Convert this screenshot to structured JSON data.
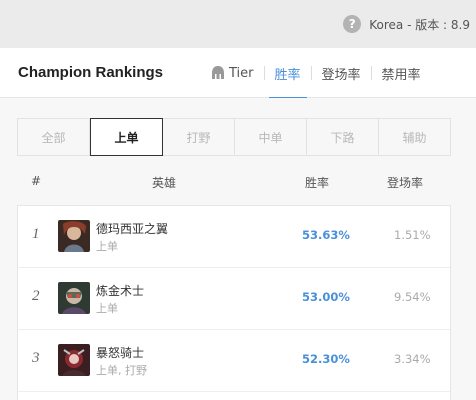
{
  "region": {
    "text": "Korea - 版本 : 8.9",
    "help_icon": "?"
  },
  "header": {
    "title": "Champion Rankings",
    "tabs": [
      {
        "label": "Tier",
        "icon": "helmet-icon",
        "active": false
      },
      {
        "label": "胜率",
        "active": true
      },
      {
        "label": "登场率",
        "active": false
      },
      {
        "label": "禁用率",
        "active": false
      }
    ]
  },
  "filters": [
    {
      "label": "全部",
      "active": false
    },
    {
      "label": "上单",
      "active": true
    },
    {
      "label": "打野",
      "active": false
    },
    {
      "label": "中单",
      "active": false
    },
    {
      "label": "下路",
      "active": false
    },
    {
      "label": "辅助",
      "active": false
    }
  ],
  "columns": {
    "rank": "#",
    "champion": "英雄",
    "winrate": "胜率",
    "pickrate": "登场率"
  },
  "rows": [
    {
      "rank": "1",
      "name": "德玛西亚之翼",
      "positions": "上单",
      "winrate": "53.63%",
      "pickrate": "1.51%",
      "avatar_color": "#6b4a3a"
    },
    {
      "rank": "2",
      "name": "炼金术士",
      "positions": "上单",
      "winrate": "53.00%",
      "pickrate": "9.54%",
      "avatar_color": "#5a6a5a"
    },
    {
      "rank": "3",
      "name": "暴怒骑士",
      "positions": "上单, 打野",
      "winrate": "52.30%",
      "pickrate": "3.34%",
      "avatar_color": "#7a3a40"
    }
  ],
  "colors": {
    "accent": "#4a90d9",
    "topbar": "#ebebeb",
    "panel": "#f7f7f7"
  }
}
